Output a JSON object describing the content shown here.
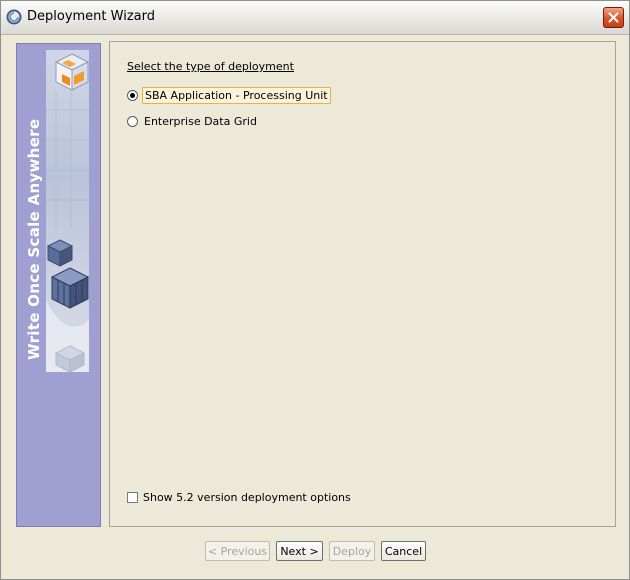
{
  "window": {
    "title": "Deployment Wizard"
  },
  "sidebar": {
    "banner_text": "Write Once Scale Anywhere"
  },
  "content": {
    "heading": "Select the type of deployment",
    "deployment_types": [
      {
        "label": "SBA Application - Processing Unit",
        "selected": true
      },
      {
        "label": "Enterprise Data Grid",
        "selected": false
      }
    ],
    "legacy_option": {
      "label": "Show 5.2 version deployment options",
      "checked": false
    }
  },
  "buttons": {
    "previous": {
      "label": "< Previous",
      "enabled": false
    },
    "next": {
      "label": "Next >",
      "enabled": true
    },
    "deploy": {
      "label": "Deploy",
      "enabled": false
    },
    "cancel": {
      "label": "Cancel",
      "enabled": true
    }
  },
  "colors": {
    "dialog_background": "#ECE9D8",
    "sidebar_background": "#9F9FD1",
    "focus_border": "#E7B24B",
    "close_button": "#D9532A"
  },
  "icons": {
    "app": "gigaspaces-logo-icon",
    "close": "close-x-icon"
  }
}
